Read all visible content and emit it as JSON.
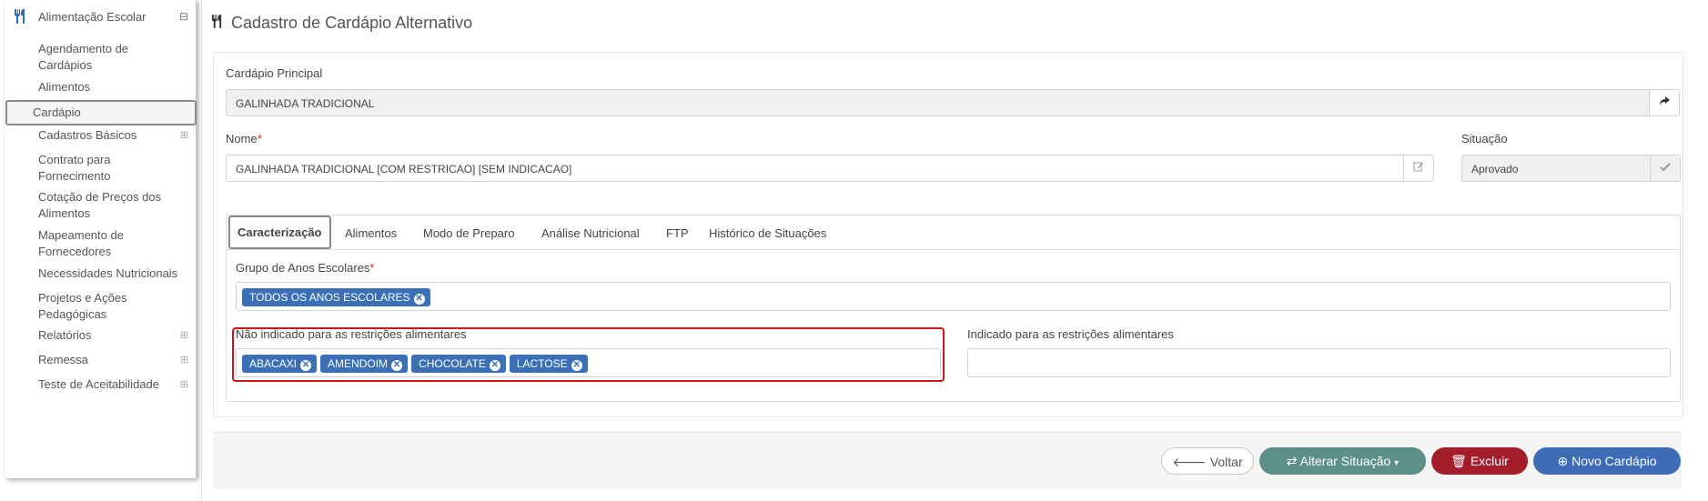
{
  "sidebar": {
    "module_label": "Alimentação Escolar",
    "module_toggle": "⊟",
    "items": [
      {
        "label": "Agendamento de Cardápios"
      },
      {
        "label": "Alimentos"
      },
      {
        "label": "Cardápio"
      },
      {
        "label": "Cadastros Básicos",
        "toggle": "⊞"
      },
      {
        "label": "Contrato para Fornecimento"
      },
      {
        "label": "Cotação de Preços dos Alimentos"
      },
      {
        "label": "Mapeamento de Fornecedores"
      },
      {
        "label": "Necessidades Nutricionais"
      },
      {
        "label": "Projetos e Ações Pedagógicas"
      },
      {
        "label": "Relatórios",
        "toggle": "⊞"
      },
      {
        "label": "Remessa",
        "toggle": "⊞"
      },
      {
        "label": "Teste de Aceitabilidade",
        "toggle": "⊞"
      }
    ]
  },
  "page": {
    "title": "Cadastro de Cardápio Alternativo"
  },
  "form": {
    "principal_label": "Cardápio Principal",
    "principal_value": "GALINHADA TRADICIONAL",
    "nome_label": "Nome",
    "nome_required": "*",
    "nome_value": "GALINHADA TRADICIONAL [COM RESTRICAO] [SEM INDICACAO]",
    "situacao_label": "Situação",
    "situacao_value": "Aprovado"
  },
  "tabs": [
    {
      "label": "Caracterização",
      "active": true
    },
    {
      "label": "Alimentos"
    },
    {
      "label": "Modo de Preparo"
    },
    {
      "label": "Análise Nutricional"
    },
    {
      "label": "FTP"
    },
    {
      "label": "Histórico de Situações"
    }
  ],
  "caracterizacao": {
    "grupo_label": "Grupo de Anos Escolares",
    "grupo_required": "*",
    "grupo_tags": [
      "TODOS OS ANOS ESCOLARES"
    ],
    "nao_indicado_label": "Não indicado para as restrições alimentares",
    "nao_indicado_tags": [
      "ABACAXI",
      "AMENDOIM",
      "CHOCOLATE",
      "LACTOSE"
    ],
    "indicado_label": "Indicado para as restrições alimentares",
    "indicado_tags": []
  },
  "buttons": {
    "voltar": "Voltar",
    "alterar": "Alterar Situação",
    "excluir": "Excluir",
    "novo": "Novo Cardápio"
  },
  "colors": {
    "accent": "#3b6fb6",
    "alterar": "#5b8f88",
    "excluir": "#a31e2a",
    "highlight": "#d0141b"
  }
}
